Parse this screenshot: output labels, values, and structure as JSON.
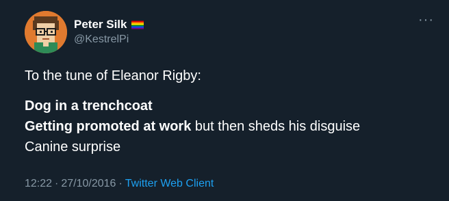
{
  "tweet": {
    "author": {
      "display_name": "Peter Silk",
      "handle": "@KestrelPi",
      "flag_icon": "rainbow-flag-icon",
      "avatar_icon": "pixel-avatar-icon"
    },
    "more_icon": "more-options-icon",
    "more_glyph": "···",
    "body": {
      "intro": "To the tune of Eleanor Rigby:",
      "line1": "Dog in a trenchcoat",
      "line2_strong": "Getting promoted at work",
      "line2_rest": " but then sheds his disguise",
      "line3": "Canine surprise"
    },
    "meta": {
      "time": "12:22",
      "date": "27/10/2016",
      "separator": "·",
      "client": "Twitter Web Client"
    }
  },
  "colors": {
    "background": "#15202b",
    "secondary_text": "#8899a6",
    "link": "#1da1f2",
    "avatar_bg": "#e07a2f"
  }
}
